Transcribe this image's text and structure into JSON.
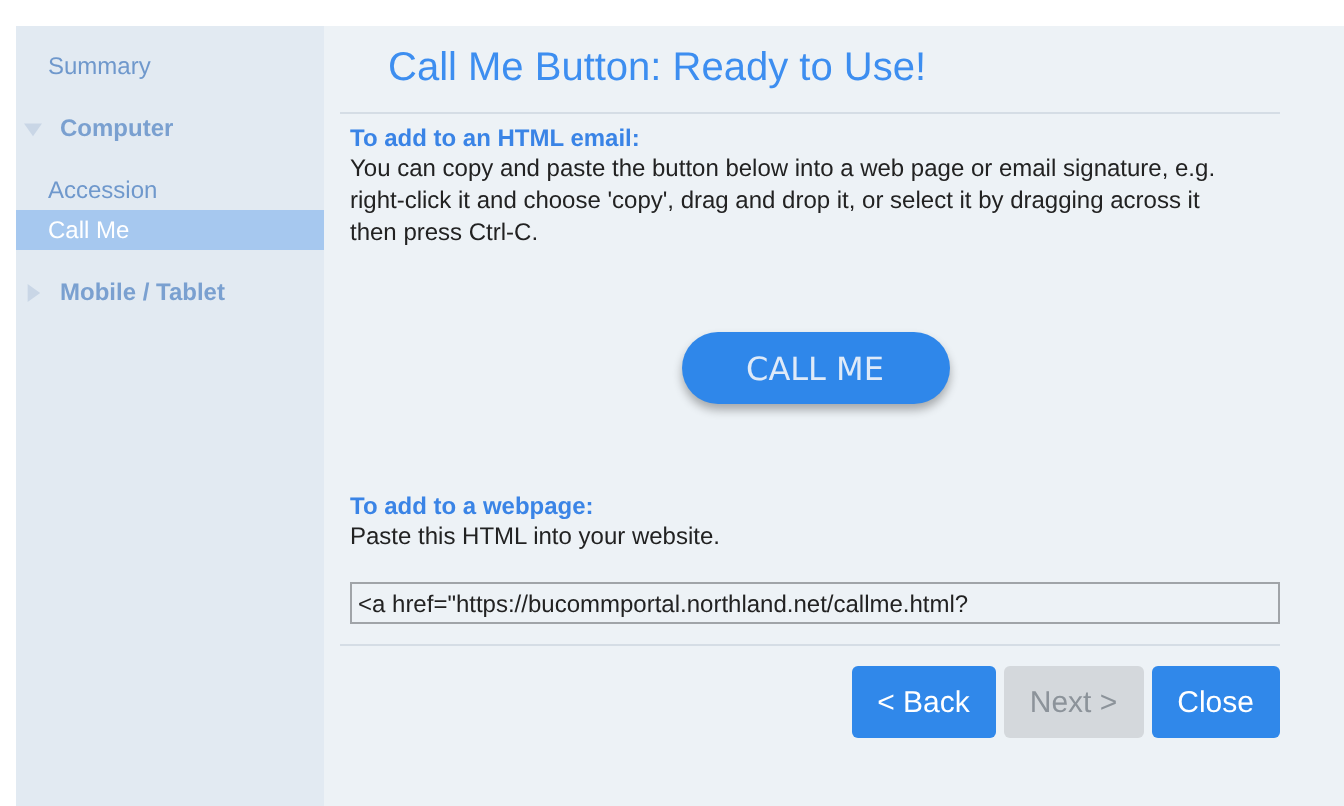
{
  "sidebar": {
    "items": [
      {
        "label": "Summary",
        "kind": "link",
        "selected": false
      },
      {
        "label": "Computer",
        "kind": "group",
        "expanded": true,
        "children": [
          {
            "label": "Accession",
            "selected": false
          },
          {
            "label": "Call Me",
            "selected": true
          }
        ]
      },
      {
        "label": "Mobile / Tablet",
        "kind": "group",
        "expanded": false
      }
    ]
  },
  "title": "Call Me Button: Ready to Use!",
  "email_section": {
    "heading": "To add to an HTML email:",
    "text": "You can copy and paste the button below into a web page or email signature, e.g. right-click it and choose 'copy', drag and drop it, or select it by dragging across it then press Ctrl-C."
  },
  "call_button": {
    "label": "CALL ME"
  },
  "webpage_section": {
    "heading": "To add to a webpage:",
    "text": "Paste this HTML into your website.",
    "code_field": {
      "value": "<a href=\"https://bucommportal.northland.net/callme.html?"
    }
  },
  "buttons": [
    {
      "label": "< Back",
      "disabled": false
    },
    {
      "label": "Next >",
      "disabled": true
    },
    {
      "label": "Close",
      "disabled": false
    }
  ]
}
